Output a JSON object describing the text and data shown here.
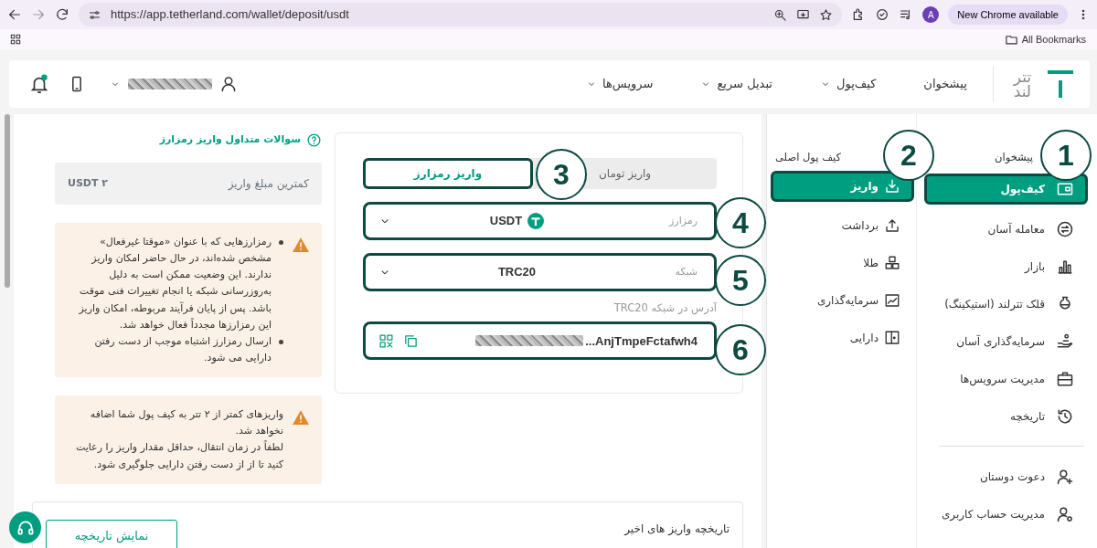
{
  "browser": {
    "url": "https://app.tetherland.com/wallet/deposit/usdt",
    "profile_initial": "A",
    "update_label": "New Chrome available",
    "bookmarks_label": "All Bookmarks"
  },
  "header": {
    "logo_lines": [
      "تتر",
      "لند"
    ],
    "nav": [
      {
        "label": "پیشخوان",
        "dropdown": false
      },
      {
        "label": "کیف‌پول",
        "dropdown": true
      },
      {
        "label": "تبدیل سریع",
        "dropdown": true
      },
      {
        "label": "سرویس‌ها",
        "dropdown": true
      }
    ],
    "notification_dot": true
  },
  "sidebar": {
    "title": "پیشخوان",
    "items": [
      {
        "label": "کیف‌پول",
        "selected": true
      },
      {
        "label": "معامله آسان",
        "selected": false
      },
      {
        "label": "بازار",
        "selected": false
      },
      {
        "label": "قلک تترلند (استیکینگ)",
        "selected": false
      },
      {
        "label": "سرمایه‌گذاری آسان",
        "selected": false
      },
      {
        "label": "مدیریت سرویس‌ها",
        "selected": false
      },
      {
        "label": "تاریخچه",
        "selected": false
      }
    ],
    "account_items": [
      {
        "label": "دعوت دوستان"
      },
      {
        "label": "مدیریت حساب کاربری"
      }
    ]
  },
  "submenu": {
    "title": "کیف پول اصلی",
    "items": [
      {
        "label": "واریز",
        "selected": true
      },
      {
        "label": "برداشت",
        "selected": false
      },
      {
        "label": "طلا",
        "selected": false
      },
      {
        "label": "سرمایه‌گذاری",
        "selected": false
      },
      {
        "label": "دارایی",
        "selected": false
      }
    ]
  },
  "deposit_form": {
    "tabs": [
      {
        "label": "واریز تومان",
        "selected": false
      },
      {
        "label": "واریز رمزارز",
        "selected": true
      }
    ],
    "currency": {
      "label": "رمزارز",
      "value": "USDT"
    },
    "network": {
      "label": "شبکه",
      "value": "TRC20"
    },
    "address_label": "آدرس در شبکه TRC20",
    "address": "...AnjTmpeFctafwh4"
  },
  "info": {
    "faq_link": "سوالات متداول واریز رمزارز",
    "min_label": "کمترین مبلغ واریز",
    "min_value": "۲ USDT",
    "warnings": [
      {
        "kind": "bullets",
        "lines": [
          "رمزارزهایی که با عنوان «موقتا غیرفعال» مشخص شده‌اند، در حال حاضر امکان واریز ندارند. این وضعیت ممکن است به دلیل به‌روزرسانی شبکه یا انجام تغییرات فنی موقت باشد. پس از پایان فرآیند مربوطه، امکان واریز این رمزارزها مجدداً فعال خواهد شد.",
          "ارسال رمزارز اشتباه موجب از دست رفتن دارایی می شود."
        ]
      },
      {
        "kind": "plain",
        "lines": [
          "واریزهای کمتر از ۲ تتر به کیف پول شما اضافه نخواهد شد.",
          "لطفاً در زمان انتقال، حداقل مقدار واریز را رعایت کنید تا از از دست رفتن دارایی جلوگیری شود."
        ]
      }
    ]
  },
  "history": {
    "title": "تاریخچه واریز های اخیر",
    "button": "نمایش تاریخچه"
  },
  "annotations": [
    {
      "label": "1"
    },
    {
      "label": "2"
    },
    {
      "label": "3"
    },
    {
      "label": "4"
    },
    {
      "label": "5"
    },
    {
      "label": "6"
    }
  ]
}
